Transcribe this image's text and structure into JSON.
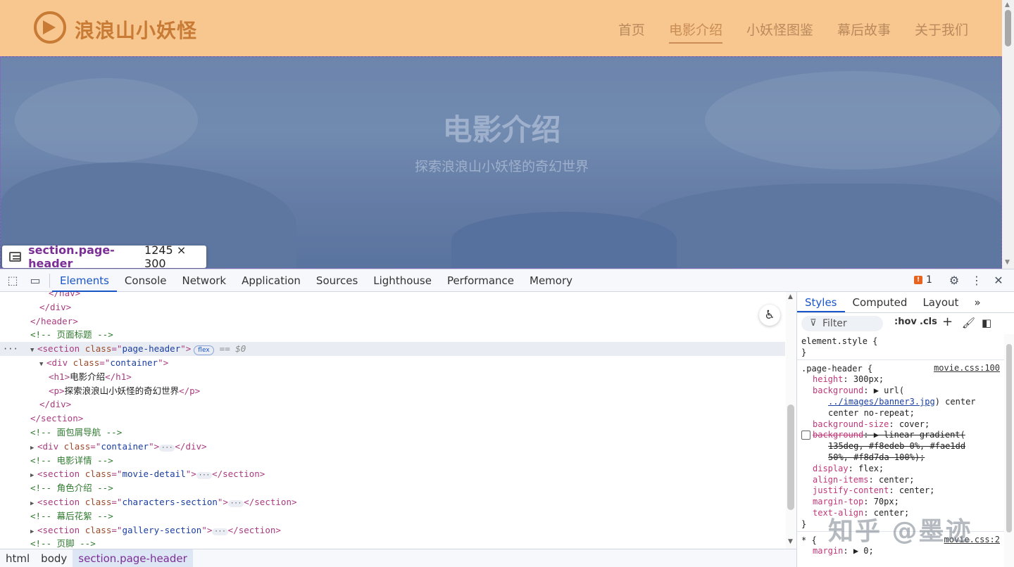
{
  "site": {
    "title": "浪浪山小妖怪",
    "nav": [
      "首页",
      "电影介绍",
      "小妖怪图鉴",
      "幕后故事",
      "关于我们"
    ],
    "active_nav": 1,
    "header_title": "电影介绍",
    "header_subtitle": "探索浪浪山小妖怪的奇幻世界",
    "header_color": "#f8c68f"
  },
  "inspect_tooltip": {
    "selector": "section.page-header",
    "size": "1245 × 300"
  },
  "devtools": {
    "tabs": [
      "Elements",
      "Console",
      "Network",
      "Application",
      "Sources",
      "Lighthouse",
      "Performance",
      "Memory"
    ],
    "active_tab": "Elements",
    "issues_count": "1",
    "accent_color": "#1a55c8",
    "tree": [
      {
        "indent": 5,
        "kind": "close",
        "text": "</nav>"
      },
      {
        "indent": 4,
        "kind": "close",
        "text": "</div>"
      },
      {
        "indent": 3,
        "kind": "close",
        "text": "</header>"
      },
      {
        "indent": 3,
        "kind": "comment",
        "text": "<!-- 页面标题 -->"
      },
      {
        "indent": 3,
        "kind": "open-selected",
        "tag": "section",
        "attr": "class",
        "val": "page-header",
        "pill": "flex",
        "eq": "== $0"
      },
      {
        "indent": 4,
        "kind": "open",
        "tag": "div",
        "attr": "class",
        "val": "container",
        "tri": "▼"
      },
      {
        "indent": 5,
        "kind": "inline",
        "tag": "h1",
        "text": "电影介绍"
      },
      {
        "indent": 5,
        "kind": "inline",
        "tag": "p",
        "text": "探索浪浪山小妖怪的奇幻世界"
      },
      {
        "indent": 4,
        "kind": "close",
        "text": "</div>"
      },
      {
        "indent": 3,
        "kind": "close",
        "text": "</section>"
      },
      {
        "indent": 3,
        "kind": "comment",
        "text": "<!-- 面包屑导航 -->"
      },
      {
        "indent": 3,
        "kind": "collapsed",
        "tag": "div",
        "attr": "class",
        "val": "container"
      },
      {
        "indent": 3,
        "kind": "comment",
        "text": "<!-- 电影详情 -->"
      },
      {
        "indent": 3,
        "kind": "collapsed",
        "tag": "section",
        "attr": "class",
        "val": "movie-detail"
      },
      {
        "indent": 3,
        "kind": "comment",
        "text": "<!-- 角色介绍 -->"
      },
      {
        "indent": 3,
        "kind": "collapsed",
        "tag": "section",
        "attr": "class",
        "val": "characters-section"
      },
      {
        "indent": 3,
        "kind": "comment",
        "text": "<!-- 幕后花絮 -->"
      },
      {
        "indent": 3,
        "kind": "collapsed",
        "tag": "section",
        "attr": "class",
        "val": "gallery-section"
      },
      {
        "indent": 3,
        "kind": "comment",
        "text": "<!-- 页脚 -->"
      }
    ],
    "breadcrumb": [
      "html",
      "body",
      "section.page-header"
    ],
    "styles": {
      "tabs": [
        "Styles",
        "Computed",
        "Layout"
      ],
      "active_tab": "Styles",
      "filter_placeholder": "Filter",
      "hov": ":hov",
      "cls": ".cls",
      "element_style": "element.style {",
      "close_brace": "}",
      "rule_selector": ".page-header {",
      "rule_source": "movie.css:100",
      "props": [
        {
          "name": "height",
          "value": "300px;"
        },
        {
          "name": "background",
          "value": "▶ url("
        },
        {
          "name": "",
          "value": "../images/banner3.jpg",
          "link": true,
          "suffix": ") center"
        },
        {
          "name": "",
          "value": "center no-repeat;"
        },
        {
          "name": "background-size",
          "value": "cover;"
        },
        {
          "name": "background",
          "value": "▶ linear-gradient(",
          "strike": true,
          "checkbox": true
        },
        {
          "name": "",
          "value": "135deg, #f8edeb 0%, #fae1dd",
          "strike": true
        },
        {
          "name": "",
          "value": "50%, #f8d7da 100%);",
          "strike": true
        },
        {
          "name": "display",
          "value": "flex;"
        },
        {
          "name": "align-items",
          "value": "center;"
        },
        {
          "name": "justify-content",
          "value": "center;"
        },
        {
          "name": "margin-top",
          "value": "70px;"
        },
        {
          "name": "text-align",
          "value": "center;"
        }
      ],
      "universal_selector": "* {",
      "universal_source": "movie.css:2",
      "universal_props": [
        {
          "name": "margin",
          "value": "▶ 0;"
        }
      ]
    }
  },
  "watermark": "知乎 @墨迹"
}
